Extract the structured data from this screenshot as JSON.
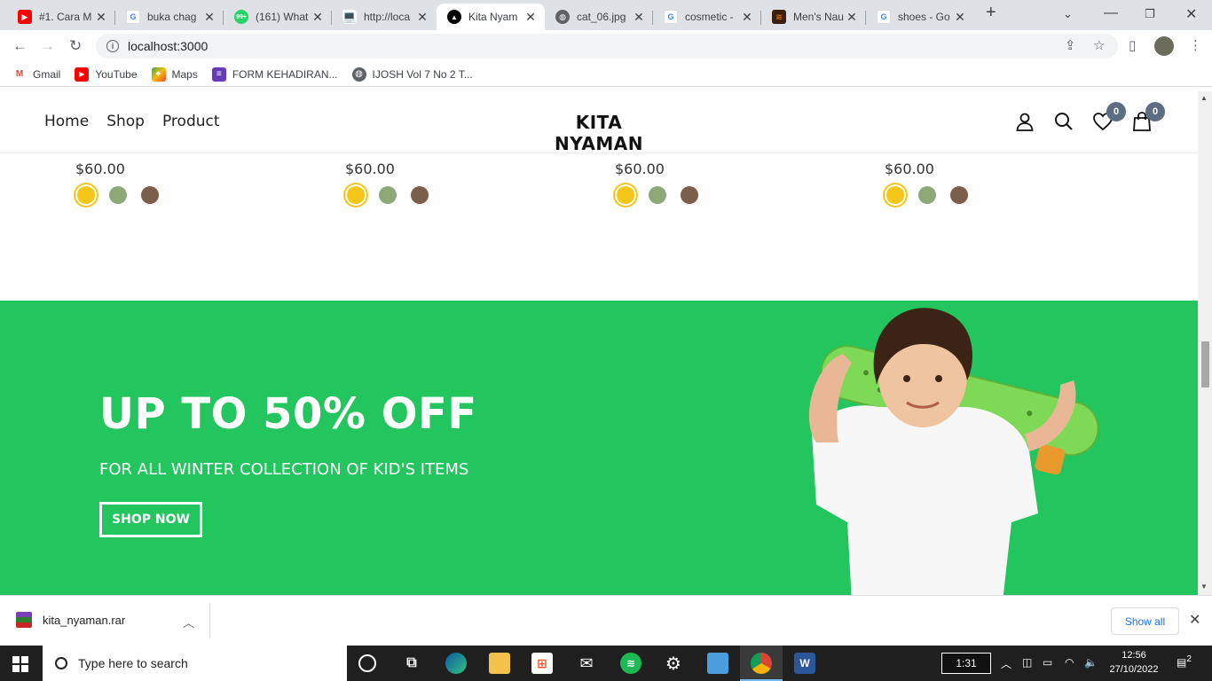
{
  "browser": {
    "tabs": [
      {
        "title": "#1. Cara M",
        "icon": "youtube-icon",
        "color": "#ff0000",
        "active": false
      },
      {
        "title": "buka chag",
        "icon": "google-icon",
        "color": "#4285f4",
        "active": false
      },
      {
        "title": "(161) What",
        "icon": "whatsapp-icon",
        "color": "#25d366",
        "badge": "99+",
        "active": false
      },
      {
        "title": "http://loca",
        "icon": "laptop-icon",
        "color": "#5f6368",
        "active": false
      },
      {
        "title": "Kita Nyam",
        "icon": "nextjs-icon",
        "color": "#000000",
        "active": true
      },
      {
        "title": "cat_06.jpg",
        "icon": "globe-icon",
        "color": "#5f6368",
        "active": false
      },
      {
        "title": "cosmetic -",
        "icon": "google-icon",
        "color": "#4285f4",
        "active": false
      },
      {
        "title": "Men's Nau",
        "icon": "site-icon",
        "color": "#e8710a",
        "active": false
      },
      {
        "title": "shoes - Go",
        "icon": "google-icon",
        "color": "#4285f4",
        "active": false
      }
    ],
    "address": "localhost:3000",
    "bookmarks": [
      {
        "label": "Gmail",
        "icon": "gmail-icon"
      },
      {
        "label": "YouTube",
        "icon": "youtube-icon"
      },
      {
        "label": "Maps",
        "icon": "maps-icon"
      },
      {
        "label": "FORM KEHADIRAN...",
        "icon": "forms-icon"
      },
      {
        "label": "IJOSH Vol 7 No 2 T...",
        "icon": "globe-icon"
      }
    ]
  },
  "site": {
    "nav": {
      "home": "Home",
      "shop": "Shop",
      "product": "Product"
    },
    "brand": "KITA NYAMAN",
    "wishlist_count": "0",
    "cart_count": "0",
    "products": [
      {
        "price": "$60.00"
      },
      {
        "price": "$60.00"
      },
      {
        "price": "$60.00"
      },
      {
        "price": "$60.00"
      }
    ],
    "swatch_colors": [
      "#f5c518",
      "#8fa878",
      "#7b5e4b"
    ],
    "banner": {
      "headline": "UP TO 50% OFF",
      "subtitle": "FOR ALL WINTER COLLECTION OF KID'S ITEMS",
      "cta": "SHOP NOW",
      "bg_color": "#22c55e"
    }
  },
  "downloads": {
    "file": "kita_nyaman.rar",
    "show_all": "Show all"
  },
  "taskbar": {
    "search_placeholder": "Type here to search",
    "timer": "1:31",
    "time": "12:56",
    "date": "27/10/2022",
    "notifications": "2"
  }
}
